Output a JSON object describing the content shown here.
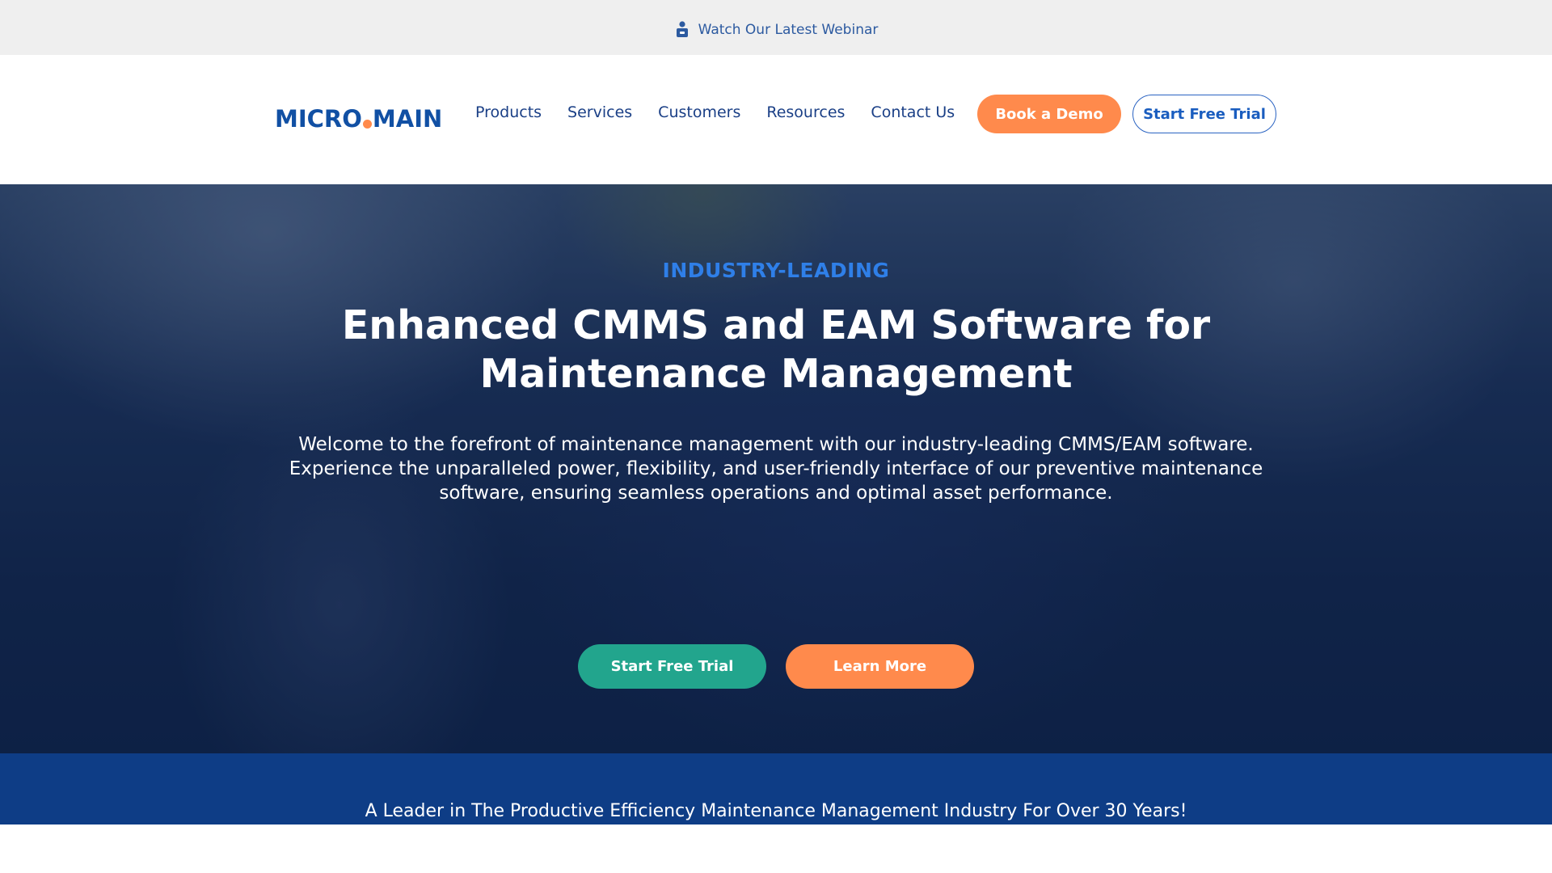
{
  "topbar": {
    "icon": "webinar-presenter-icon",
    "link_label": "Watch Our Latest Webinar"
  },
  "header": {
    "logo_left": "MICRO",
    "logo_right": "MAIN",
    "nav": [
      {
        "label": "Products"
      },
      {
        "label": "Services"
      },
      {
        "label": "Customers"
      },
      {
        "label": "Resources"
      },
      {
        "label": "Contact Us"
      }
    ],
    "demo_button": "Book a Demo",
    "trial_button": "Start Free Trial"
  },
  "hero": {
    "eyebrow": "INDUSTRY-LEADING",
    "title": "Enhanced CMMS and EAM Software for Maintenance Management",
    "description": "Welcome to the forefront of maintenance management with our industry-leading CMMS/EAM software. Experience the unparalleled power, flexibility, and user-friendly interface of our preventive maintenance software, ensuring seamless operations and optimal asset performance.",
    "primary_button": "Start Free Trial",
    "secondary_button": "Learn More"
  },
  "leader": {
    "text": "A Leader in The Productive Efficiency Maintenance Management Industry For Over 30 Years!"
  },
  "colors": {
    "brand_blue": "#1150a4",
    "accent_orange": "#ff8a4c",
    "teal": "#22a58d",
    "eyebrow_blue": "#2f7fe8",
    "strip_navy": "#0e3d86"
  }
}
